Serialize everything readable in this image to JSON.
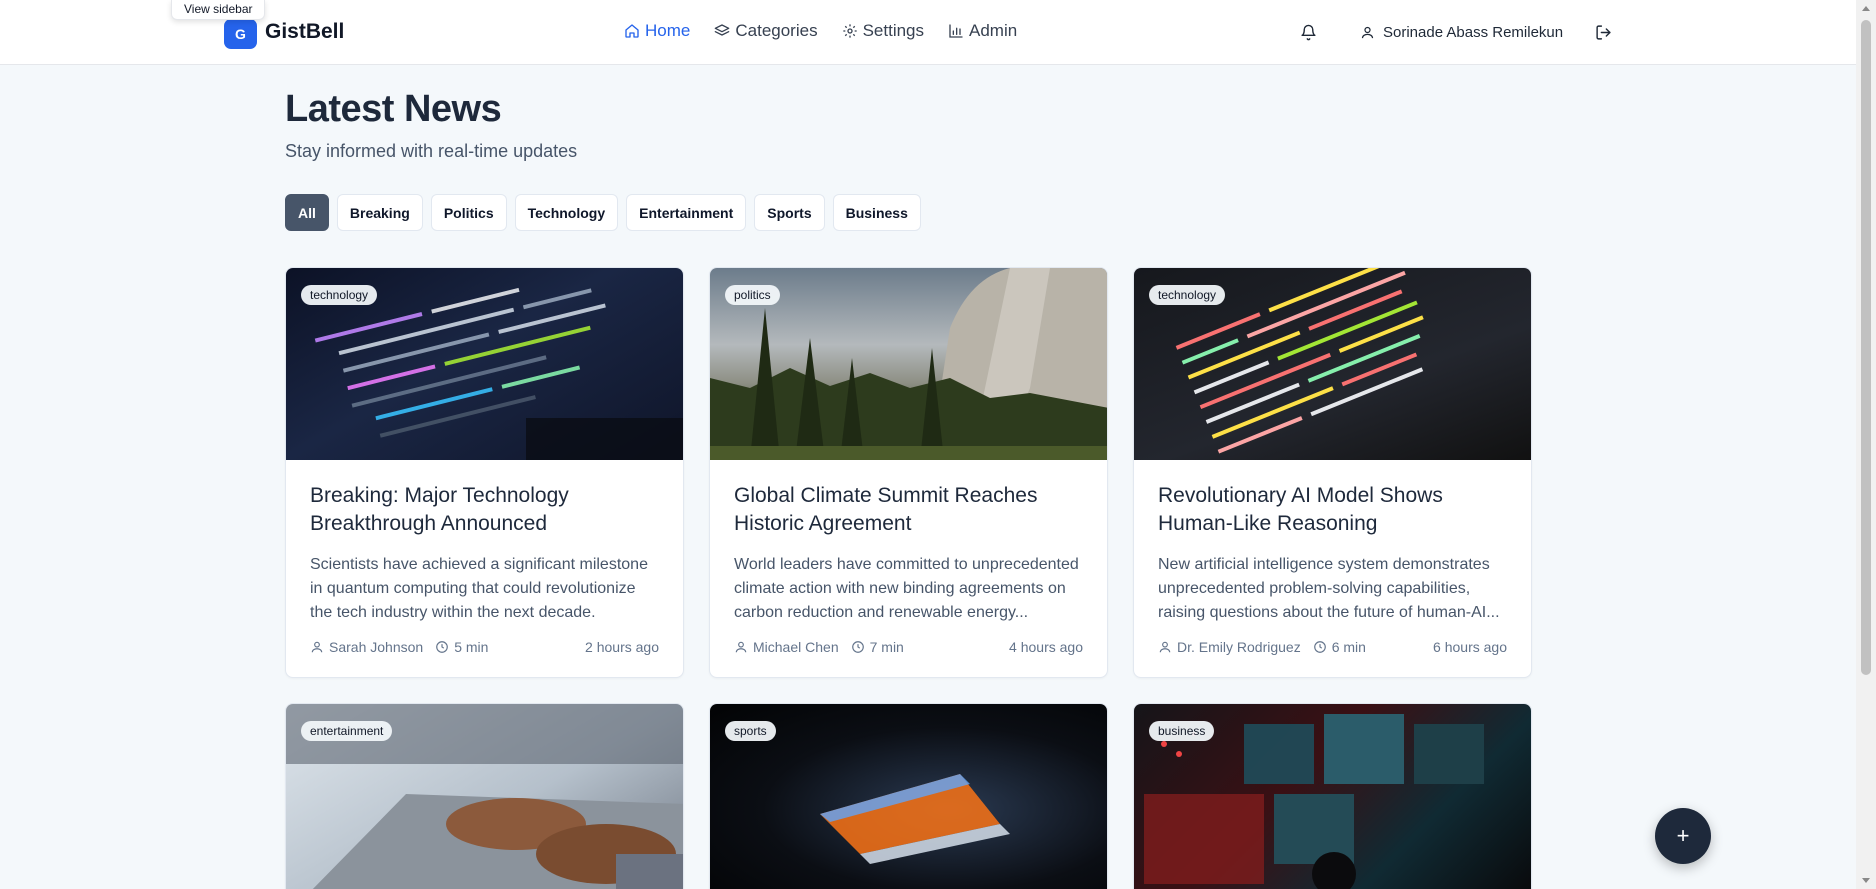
{
  "tooltip": "View sidebar",
  "brand": {
    "badge": "G",
    "name": "GistBell"
  },
  "nav": [
    {
      "label": "Home",
      "icon": "home-icon",
      "active": true
    },
    {
      "label": "Categories",
      "icon": "layers-icon",
      "active": false
    },
    {
      "label": "Settings",
      "icon": "gear-icon",
      "active": false
    },
    {
      "label": "Admin",
      "icon": "bar-chart-icon",
      "active": false
    }
  ],
  "user": {
    "name": "Sorinade Abass Remilekun"
  },
  "page": {
    "title": "Latest News",
    "subtitle": "Stay informed with real-time updates"
  },
  "filters": [
    "All",
    "Breaking",
    "Politics",
    "Technology",
    "Entertainment",
    "Sports",
    "Business"
  ],
  "active_filter": "All",
  "articles": [
    {
      "tag": "technology",
      "title": "Breaking: Major Technology Breakthrough Announced",
      "summary": "Scientists have achieved a significant milestone in quantum computing that could revolutionize the tech industry within the next decade.",
      "author": "Sarah Johnson",
      "read_time": "5 min",
      "time_ago": "2 hours ago"
    },
    {
      "tag": "politics",
      "title": "Global Climate Summit Reaches Historic Agreement",
      "summary": "World leaders have committed to unprecedented climate action with new binding agreements on carbon reduction and renewable energy...",
      "author": "Michael Chen",
      "read_time": "7 min",
      "time_ago": "4 hours ago"
    },
    {
      "tag": "technology",
      "title": "Revolutionary AI Model Shows Human-Like Reasoning",
      "summary": "New artificial intelligence system demonstrates unprecedented problem-solving capabilities, raising questions about the future of human-AI...",
      "author": "Dr. Emily Rodriguez",
      "read_time": "6 min",
      "time_ago": "6 hours ago"
    },
    {
      "tag": "entertainment"
    },
    {
      "tag": "sports"
    },
    {
      "tag": "business"
    }
  ],
  "fab_label": "+",
  "colors": {
    "accent": "#2563eb",
    "dark": "#1e293b",
    "chip_active": "#475569",
    "background": "#f4f8fb"
  }
}
